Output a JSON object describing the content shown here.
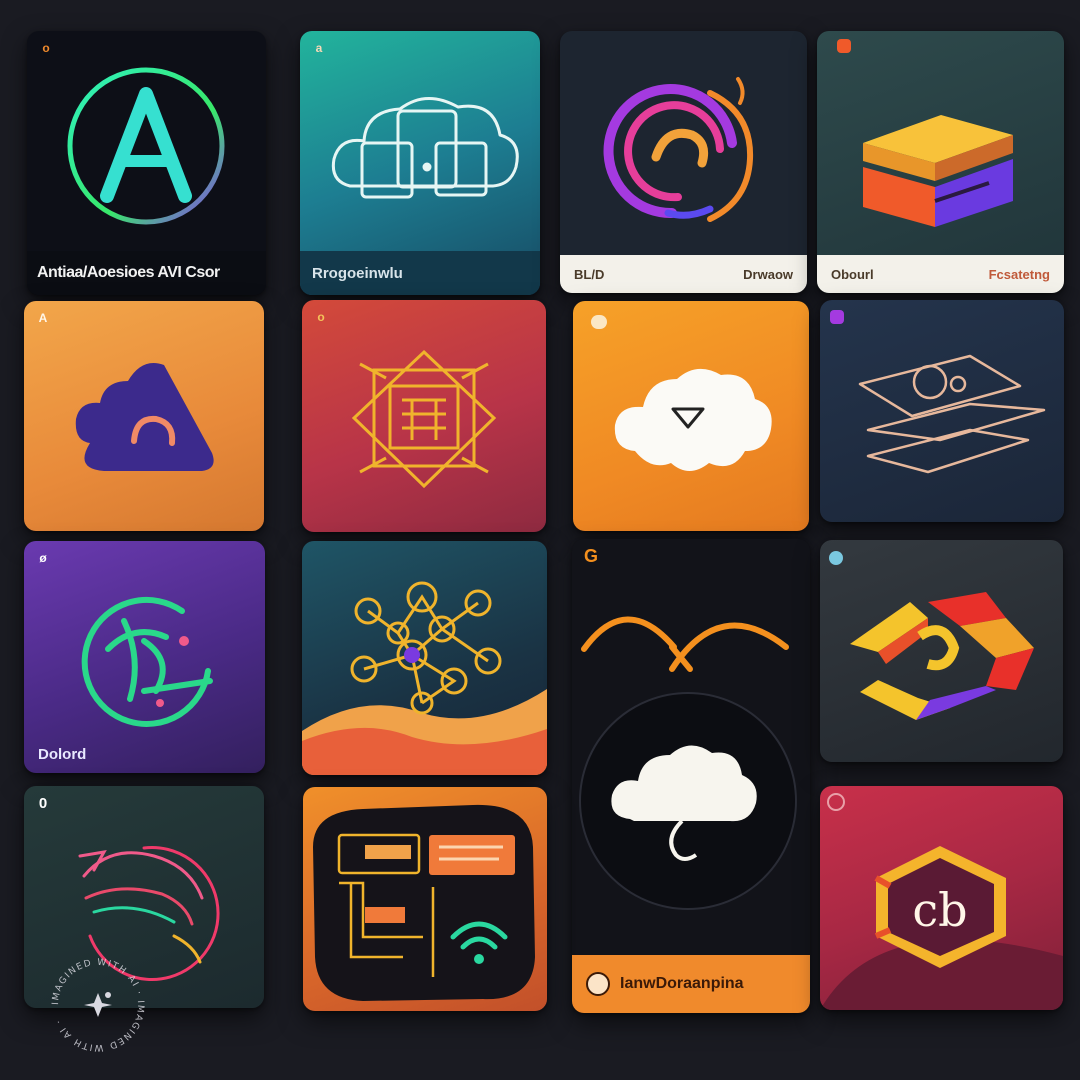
{
  "tiles": {
    "r1c1": {
      "badge": "o",
      "footer": "Antiaa/Aoesioes AVI Csor"
    },
    "r1c2": {
      "badge": "a",
      "footer": "Rrogoeinwlu"
    },
    "r1c3": {
      "footer_left": "BL/D",
      "footer_right": "Drwaow"
    },
    "r1c4": {
      "footer_left": "Obourl",
      "footer_right": "Fcsatetng"
    },
    "r2c1": {
      "badge": "A"
    },
    "r2c2": {
      "badge": "o"
    },
    "r3c1": {
      "badge": "ø",
      "label": "Dolord"
    },
    "r3c3": {
      "badge": "G"
    },
    "r4c1": {
      "badge": "0"
    },
    "r4c3": {
      "footer": "IanwDoraanpina"
    }
  },
  "watermark": {
    "text": "IMAGINED WITH AI · IMAGINED WITH AI ·"
  }
}
